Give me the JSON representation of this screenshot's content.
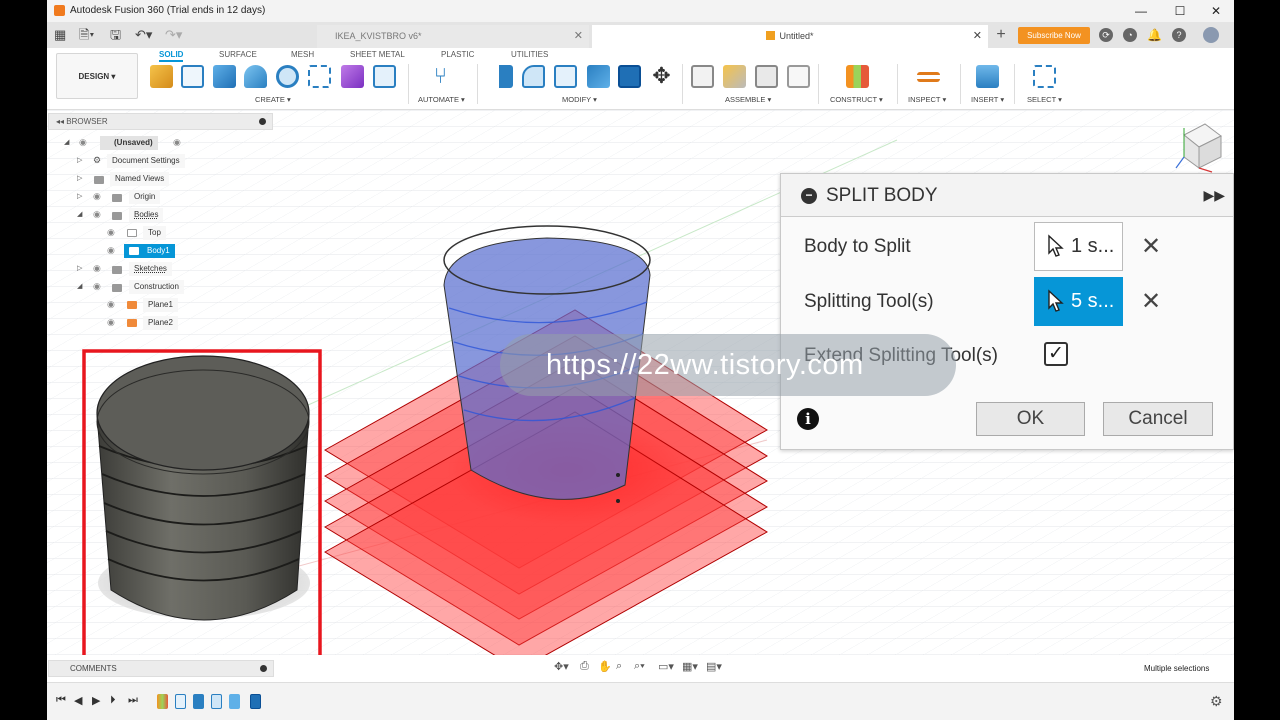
{
  "window": {
    "title": "Autodesk Fusion 360 (Trial ends in 12 days)",
    "controls": [
      "—",
      "☐",
      "✕"
    ]
  },
  "tabs": {
    "inactive": "IKEA_KVISTBRO v6*",
    "active": "Untitled*",
    "subscribe": "Subscribe Now"
  },
  "ribbon": {
    "design": "DESIGN ▾",
    "workspace_tabs": [
      "SOLID",
      "SURFACE",
      "MESH",
      "SHEET METAL",
      "PLASTIC",
      "UTILITIES"
    ],
    "groups": [
      "CREATE ▾",
      "AUTOMATE ▾",
      "MODIFY ▾",
      "ASSEMBLE ▾",
      "CONSTRUCT ▾",
      "INSPECT ▾",
      "INSERT ▾",
      "SELECT ▾"
    ]
  },
  "browser": {
    "header": "BROWSER",
    "items": [
      "(Unsaved)",
      "Document Settings",
      "Named Views",
      "Origin",
      "Bodies",
      "Top",
      "Body1",
      "Sketches",
      "Construction",
      "Plane1",
      "Plane2"
    ]
  },
  "dialog": {
    "title": "SPLIT BODY",
    "body_label": "Body to Split",
    "body_value": "1 s...",
    "tool_label": "Splitting Tool(s)",
    "tool_value": "5 s...",
    "extend_label": "Extend Splitting Tool(s)",
    "extend_checked": true,
    "ok": "OK",
    "cancel": "Cancel",
    "info": "i"
  },
  "watermark": "https://22ww.tistory.com",
  "comments": "COMMENTS",
  "status": "Multiple selections",
  "colors": {
    "accent": "#0696d7",
    "plane": "#ff3b3b",
    "body": "#5a6fd0",
    "highlight": "#e8161e",
    "subscribe": "#f39221"
  }
}
